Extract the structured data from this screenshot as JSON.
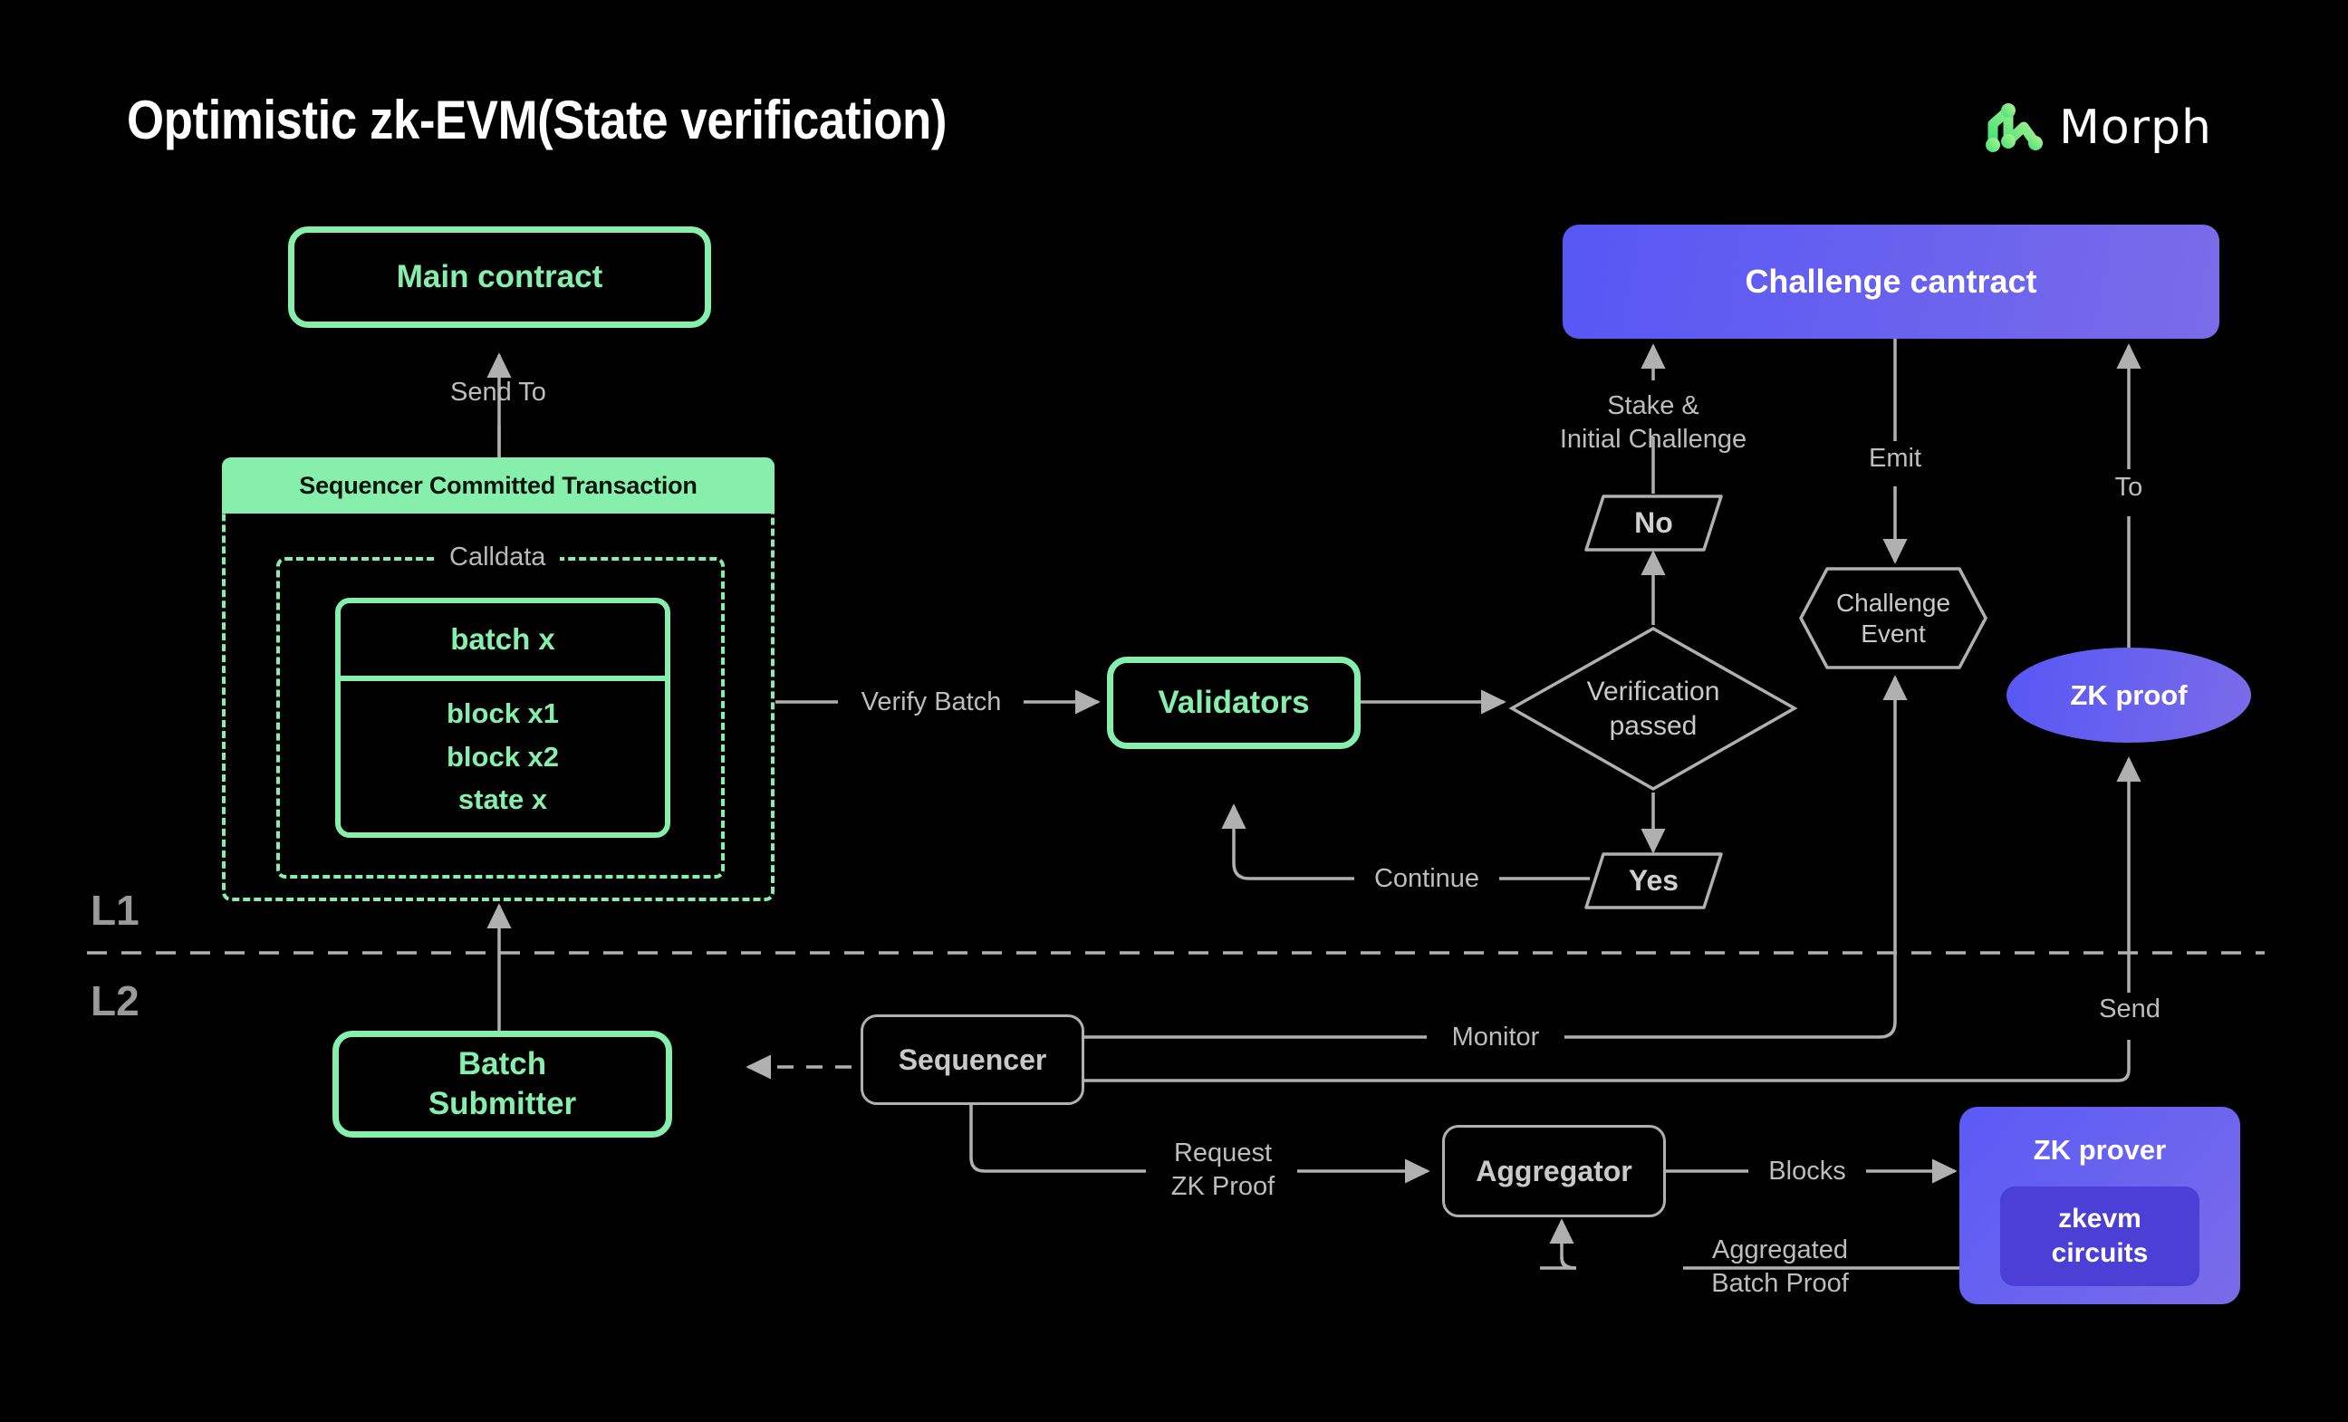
{
  "header": {
    "title": "Optimistic zk-EVM(State verification)",
    "logo_mark": "morph-node-logo-icon",
    "logo_text": "Morph"
  },
  "colors": {
    "background": "#000000",
    "green": "#86efac",
    "purple_start": "#5757f5",
    "purple_end": "#7a6ce9",
    "edge_grey": "#b0b0b0",
    "label_grey": "#bdbdbd"
  },
  "layers": {
    "l1": "L1",
    "l2": "L2"
  },
  "nodes": {
    "main_contract": "Main contract",
    "sequencer_committed_transaction": "Sequencer Committed Transaction",
    "calldata": "Calldata",
    "batch": {
      "title": "batch x",
      "rows": [
        "block x1",
        "block x2",
        "state x"
      ]
    },
    "validators": "Validators",
    "verification_passed": "Verification passed",
    "verification_passed_l1": "Verification",
    "verification_passed_l2": "passed",
    "no": "No",
    "yes": "Yes",
    "challenge_contract": "Challenge cantract",
    "challenge_event": "Challenge Event",
    "challenge_event_l1": "Challenge",
    "challenge_event_l2": "Event",
    "zk_proof": "ZK proof",
    "batch_submitter": "Batch Submitter",
    "batch_submitter_l1": "Batch",
    "batch_submitter_l2": "Submitter",
    "sequencer": "Sequencer",
    "aggregator": "Aggregator",
    "zk_prover": "ZK prover",
    "zkevm_circuits": "zkevm circuits",
    "zkevm_circuits_l1": "zkevm",
    "zkevm_circuits_l2": "circuits"
  },
  "edges": {
    "send_to": "Send To",
    "verify_batch": "Verify Batch",
    "stake_initial_challenge_l1": "Stake &",
    "stake_initial_challenge_l2": "Initial Challenge",
    "emit": "Emit",
    "to": "To",
    "continue": "Continue",
    "monitor": "Monitor",
    "send": "Send",
    "request_zk_proof_l1": "Request",
    "request_zk_proof_l2": "ZK Proof",
    "blocks": "Blocks",
    "aggregated_batch_proof_l1": "Aggregated",
    "aggregated_batch_proof_l2": "Batch Proof"
  }
}
